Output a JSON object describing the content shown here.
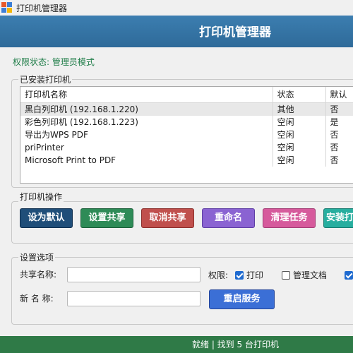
{
  "window": {
    "title": "打印机管理器"
  },
  "header": {
    "title": "打印机管理器"
  },
  "permission_status": "权限状态: 管理员模式",
  "installed_printers": {
    "group_title": "已安装打印机",
    "columns": [
      "打印机名称",
      "状态",
      "默认"
    ],
    "rows": [
      {
        "name": "黑白列印机 (192.168.1.220)",
        "status": "其他",
        "default": "否",
        "selected": true
      },
      {
        "name": "彩色列印机 (192.168.1.223)",
        "status": "空闲",
        "default": "是",
        "selected": false
      },
      {
        "name": "导出为WPS PDF",
        "status": "空闲",
        "default": "否",
        "selected": false
      },
      {
        "name": "priPrinter",
        "status": "空闲",
        "default": "否",
        "selected": false
      },
      {
        "name": "Microsoft Print to PDF",
        "status": "空闲",
        "default": "否",
        "selected": false
      }
    ]
  },
  "printer_ops": {
    "group_title": "打印机操作",
    "buttons": [
      {
        "label": "设为默认",
        "color": "#1f4e79",
        "border": "#0f2f4f"
      },
      {
        "label": "设置共享",
        "color": "#2e8b57",
        "border": "#1b5e38"
      },
      {
        "label": "取消共享",
        "color": "#c0504d",
        "border": "#8b2f2c"
      },
      {
        "label": "重命名",
        "color": "#8a63d2",
        "border": "#5e3ea3"
      },
      {
        "label": "清理任务",
        "color": "#d65a9c",
        "border": "#a23c74"
      },
      {
        "label": "安装打",
        "color": "#27ae9f",
        "border": "#177a6f"
      }
    ]
  },
  "settings": {
    "group_title": "设置选项",
    "share_name_label": "共享名称:",
    "share_name_value": "",
    "new_name_label": "新 名 称:",
    "new_name_value": "",
    "permissions_label": "权限:",
    "permissions": [
      {
        "label": "打印",
        "checked": true
      },
      {
        "label": "管理文档",
        "checked": false
      },
      {
        "label": "",
        "checked": true
      }
    ],
    "restart_button": "重启服务"
  },
  "status_bar": {
    "text": "就绪 | 找到 5 台打印机"
  }
}
